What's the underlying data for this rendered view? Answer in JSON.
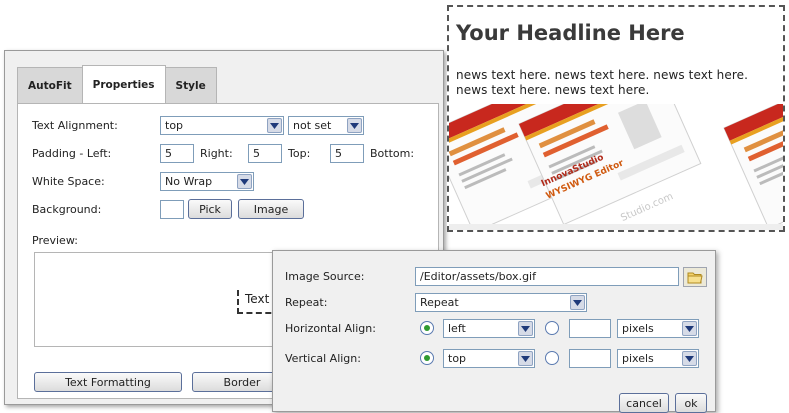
{
  "props_dialog": {
    "tabs": [
      {
        "label": "AutoFit"
      },
      {
        "label": "Properties"
      },
      {
        "label": "Style"
      }
    ],
    "text_alignment": {
      "label": "Text Alignment:",
      "value": "top",
      "value2": "not set"
    },
    "padding": {
      "label": "Padding - Left:",
      "left": "5",
      "right_label": "Right:",
      "right": "5",
      "top_label": "Top:",
      "top": "5",
      "bottom_label": "Bottom:"
    },
    "white_space": {
      "label": "White Space:",
      "value": "No Wrap"
    },
    "background": {
      "label": "Background:",
      "pick": "Pick",
      "image": "Image"
    },
    "preview": {
      "label": "Preview:",
      "text": "Text"
    },
    "buttons": {
      "text_formatting": "Text Formatting",
      "border": "Border"
    }
  },
  "web_preview": {
    "headline": "Your Headline Here",
    "news": "news text here. news text here. news text here. news text here. news text here.",
    "card_brand": "InnovaStudio",
    "card_product": "WYSIWYG Editor",
    "card_url": "Studio.com"
  },
  "image_dialog": {
    "source": {
      "label": "Image Source:",
      "value": "/Editor/assets/box.gif"
    },
    "repeat": {
      "label": "Repeat:",
      "value": "Repeat"
    },
    "h_align": {
      "label": "Horizontal Align:",
      "value": "left",
      "unit": "pixels"
    },
    "v_align": {
      "label": "Vertical Align:",
      "value": "top",
      "unit": "pixels"
    },
    "buttons": {
      "cancel": "cancel",
      "ok": "ok"
    }
  },
  "colors": {
    "accent_red": "#c8281e",
    "input_border": "#7f9db9",
    "radio_green": "#2f9a2f"
  }
}
